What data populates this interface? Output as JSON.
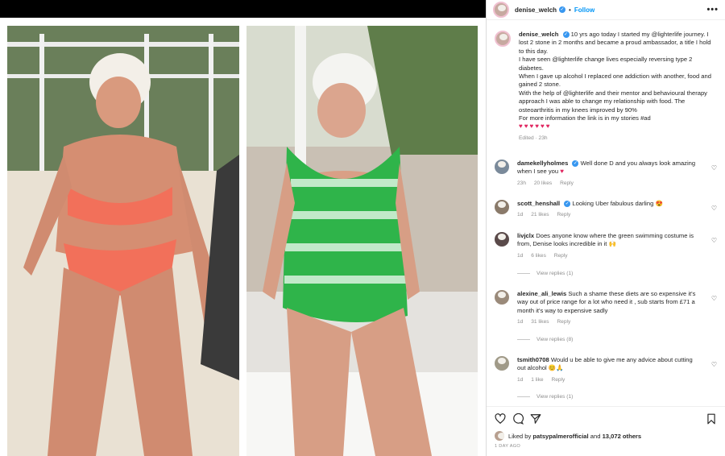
{
  "post": {
    "username": "denise_welch",
    "follow_label": "Follow",
    "separator": "•",
    "caption": {
      "username": "denise_welch",
      "lines": [
        "10 yrs ago today I started my @lighterlife journey. I lost 2 stone in 2 months and became a proud ambassador, a title I hold to this day.",
        "I have seen @lighterlife change lives especially reversing type 2 diabetes.",
        "When I gave up alcohol I replaced one addiction with another, food and gained 2 stone.",
        "With the help of @lighterlife and their mentor and behavioural therapy approach I was able to change my relationship with food. The osteoarthritis in my knees improved by 90%",
        "For more information the link is in my stories #ad"
      ],
      "hearts": "♥♥♥♥♥♥",
      "meta": "Edited · 23h"
    }
  },
  "comments": [
    {
      "user": "damekellyholmes",
      "verified": true,
      "text": "Well done D and you always look amazing when I see you",
      "emoji": "♥",
      "time": "23h",
      "likes": "20 likes",
      "reply": "Reply"
    },
    {
      "user": "scott_henshall",
      "verified": true,
      "text": "Looking Uber fabulous darling",
      "emoji": "😍",
      "time": "1d",
      "likes": "21 likes",
      "reply": "Reply"
    },
    {
      "user": "livjclx",
      "verified": false,
      "text": "Does anyone know where the green swimming costume is from, Denise looks incredible in it",
      "emoji": "🙌",
      "time": "1d",
      "likes": "6 likes",
      "reply": "Reply",
      "view_replies": "View replies (1)"
    },
    {
      "user": "alexine_ali_lewis",
      "verified": false,
      "text": "Such a shame these diets are so expensive it's way out of price range for a lot who need it , sub starts from £71 a month it's way to expensive sadly",
      "emoji": "",
      "time": "1d",
      "likes": "31 likes",
      "reply": "Reply",
      "view_replies": "View replies (8)"
    },
    {
      "user": "tsmith0708",
      "verified": false,
      "text": "Would u be able to give me any advice about cutting out alcohol",
      "emoji": "😊🙏",
      "time": "1d",
      "likes": "1 like",
      "reply": "Reply",
      "view_replies": "View replies (1)"
    }
  ],
  "footer": {
    "liked_by_prefix": "Liked by",
    "liked_by_user": "patsypalmerofficial",
    "liked_by_suffix": "and",
    "liked_count": "13,072 others",
    "date": "1 DAY AGO"
  },
  "icons": {
    "like": "heart-icon",
    "comment": "comment-icon",
    "share": "share-icon",
    "save": "bookmark-icon",
    "more": "more-icon",
    "verified": "verified-badge-icon"
  },
  "colors": {
    "accent": "#0095f6",
    "verified": "#3897f0",
    "heart": "#e0245e",
    "muted": "#8e8e8e"
  }
}
